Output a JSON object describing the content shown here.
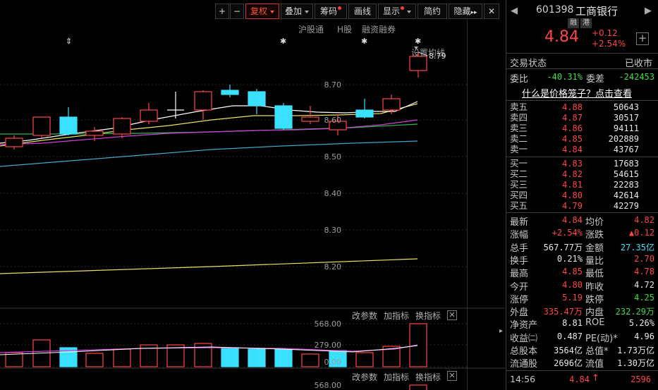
{
  "toolbar": {
    "plus": "+",
    "minus": "−",
    "fuquan": "复权",
    "diejia": "叠加",
    "chouma": "筹码",
    "huaxian": "画线",
    "xianshi": "显示",
    "jianyue": "简约",
    "yincang": "隐藏",
    "yincang_arrows": "▸▸",
    "close": "✕"
  },
  "subnav": {
    "hugutong": "沪股通",
    "hgu": "H股",
    "rongzi": "融资融券",
    "shezhi": "设置均线"
  },
  "chart": {
    "last_high_label": "8.79",
    "y_ticks": [
      "8.70",
      "8.60",
      "8.50",
      "8.40",
      "8.30",
      "8.20"
    ],
    "markers": [
      "⇕",
      "✱",
      "✱",
      "✱"
    ]
  },
  "volume_panel": {
    "gaicanshu": "改参数",
    "jiazhibiao": "加指标",
    "huanzhibiao": "换指标",
    "close": "✕",
    "y_ticks": [
      "568.00",
      "279.00",
      "0.00"
    ]
  },
  "lower_panel": {
    "gaicanshu": "改参数",
    "jiazhibiao": "加指标",
    "huanzhibiao": "换指标",
    "close": "✕",
    "y_top": "568.00"
  },
  "stock": {
    "code": "601398",
    "name": "工商银行",
    "tag_rong": "融",
    "tag_gang": "港",
    "price": "4.84",
    "change": "+0.12",
    "change_pct": "+2.54%",
    "status_label": "交易状态",
    "status_value": "已收市",
    "weibi_label": "委比",
    "weibi_value": "-40.31%",
    "weicha_label": "委差",
    "weicha_value": "-242453",
    "cage_link": "什么是价格笼子？点击查看"
  },
  "sell_orders": [
    {
      "label": "卖五",
      "price": "4.88",
      "vol": "50643"
    },
    {
      "label": "卖四",
      "price": "4.87",
      "vol": "30517"
    },
    {
      "label": "卖三",
      "price": "4.86",
      "vol": "94111"
    },
    {
      "label": "卖二",
      "price": "4.85",
      "vol": "202889"
    },
    {
      "label": "卖一",
      "price": "4.84",
      "vol": "43767"
    }
  ],
  "buy_orders": [
    {
      "label": "买一",
      "price": "4.83",
      "vol": "17683"
    },
    {
      "label": "买二",
      "price": "4.82",
      "vol": "54615"
    },
    {
      "label": "买三",
      "price": "4.81",
      "vol": "22283"
    },
    {
      "label": "买四",
      "price": "4.80",
      "vol": "42614"
    },
    {
      "label": "买五",
      "price": "4.79",
      "vol": "42279"
    }
  ],
  "stats": [
    {
      "l1": "最新",
      "v1": "4.84",
      "c1": "red",
      "l2": "均价",
      "v2": "4.82",
      "c2": "red"
    },
    {
      "l1": "涨幅",
      "v1": "+2.54%",
      "c1": "red",
      "l2": "涨跌",
      "v2": "▲0.12",
      "c2": "red"
    },
    {
      "l1": "总手",
      "v1": "567.77万",
      "c1": "white",
      "l2": "金额",
      "v2": "27.35亿",
      "c2": "cyan"
    },
    {
      "l1": "换手",
      "v1": "0.21%",
      "c1": "white",
      "l2": "量比",
      "v2": "2.70",
      "c2": "red"
    },
    {
      "l1": "最高",
      "v1": "4.85",
      "c1": "red",
      "l2": "最低",
      "v2": "4.78",
      "c2": "red"
    },
    {
      "l1": "今开",
      "v1": "4.80",
      "c1": "red",
      "l2": "昨收",
      "v2": "4.72",
      "c2": "white"
    },
    {
      "l1": "涨停",
      "v1": "5.19",
      "c1": "red",
      "l2": "跌停",
      "v2": "4.25",
      "c2": "green"
    },
    {
      "l1": "外盘",
      "v1": "335.47万",
      "c1": "red",
      "l2": "内盘",
      "v2": "232.29万",
      "c2": "green"
    },
    {
      "l1": "净资产",
      "v1": "8.81",
      "c1": "white",
      "l2": "ROE",
      "v2": "5.26%",
      "c2": "white"
    },
    {
      "l1": "收益㈡",
      "v1": "0.487",
      "c1": "white",
      "l2": "PE(动)*",
      "v2": "4.96",
      "c2": "white"
    },
    {
      "l1": "总股本",
      "v1": "3564亿",
      "c1": "white",
      "l2": "总值*",
      "v2": "1.73万亿",
      "c2": "white"
    },
    {
      "l1": "流通股",
      "v1": "2696亿",
      "c1": "white",
      "l2": "流值",
      "v2": "1.30万亿",
      "c2": "white"
    }
  ],
  "tick": {
    "time": "14:56",
    "price": "4.84",
    "arrow": "↑",
    "vol": "2596"
  },
  "colors": {
    "up": "#ff4545",
    "down": "#39e0ff",
    "bg": "#000000",
    "grid": "#2a2a2a"
  }
}
